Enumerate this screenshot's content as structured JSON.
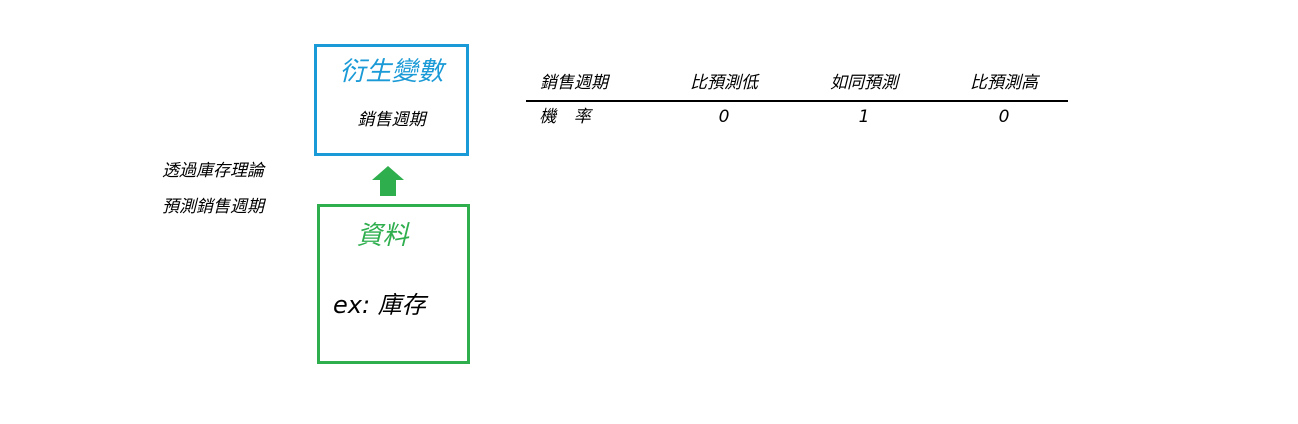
{
  "colors": {
    "derived_accent": "#1a9ad6",
    "data_accent": "#2fae4e",
    "arrow": "#2fae4e"
  },
  "derived_box": {
    "title": "衍生變數",
    "subtitle": "銷售週期"
  },
  "data_box": {
    "title": "資料",
    "example": "ex: 庫存"
  },
  "arrow_icon": "arrow-up-icon",
  "side_note": {
    "line1": "透過庫存理論",
    "line2": "預測銷售週期"
  },
  "table": {
    "headers": [
      "銷售週期",
      "比預測低",
      "如同預測",
      "比預測高"
    ],
    "rows": [
      [
        "機 率",
        "0",
        "1",
        "0"
      ]
    ]
  }
}
